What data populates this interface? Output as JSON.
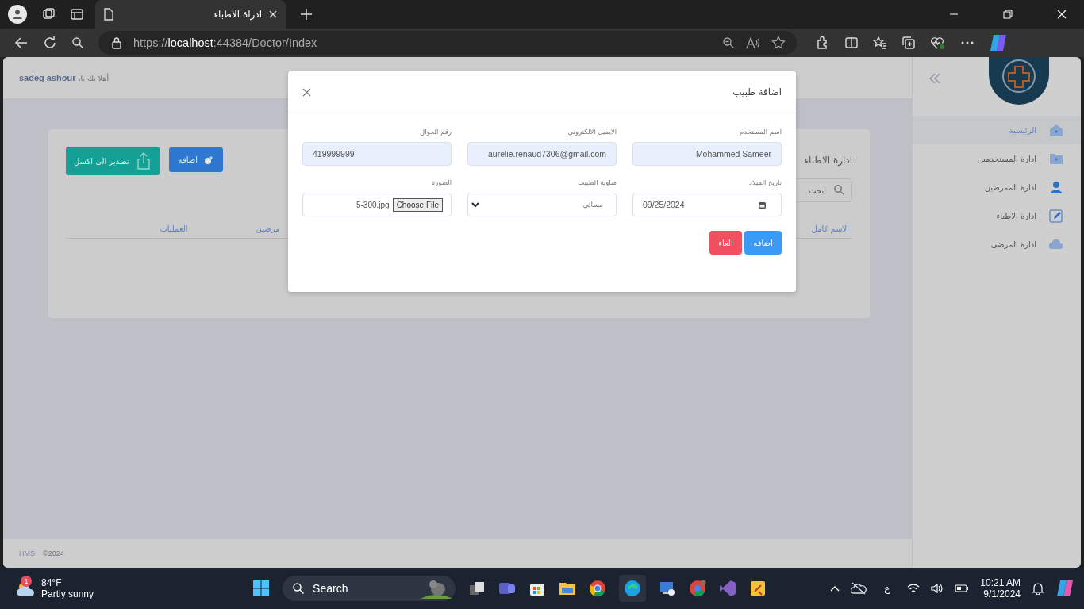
{
  "browser": {
    "tabs": [
      {
        "title": "ادراة الاطباء",
        "selected": true
      }
    ],
    "url": {
      "scheme": "https://",
      "host": "localhost",
      "path": ":44384/Doctor/Index"
    }
  },
  "header": {
    "greeting": "أهلا بك يا،",
    "user": "sadeg ashour"
  },
  "sidebar": {
    "items": [
      {
        "label": "الرئيسية",
        "selected": true
      },
      {
        "label": "ادارة المستخدمين",
        "selected": false
      },
      {
        "label": "ادارة الممرضين",
        "selected": false
      },
      {
        "label": "ادارة الاطباء",
        "selected": false
      },
      {
        "label": "ادارة المرضى",
        "selected": false
      }
    ]
  },
  "card": {
    "title": "ادارة الاطباء",
    "add_button": "اضافة",
    "export_button": "تصدير الى اكسل",
    "search": {
      "placeholder": "أبحث"
    },
    "table": {
      "columns": [
        "الاسم كامل",
        "مرضين",
        "العمليات"
      ]
    }
  },
  "modal": {
    "title": "اضافة طبيب",
    "fields": [
      {
        "kind": "text",
        "label": "اسم المستخدم",
        "value": "Mohammed Sameer"
      },
      {
        "kind": "text",
        "label": "الايميل الالكتروني",
        "value": "aurelie.renaud7306@gmail.com"
      },
      {
        "kind": "text",
        "label": "رقم الجوال",
        "value": "419999999"
      },
      {
        "kind": "date",
        "label": "تاريخ الميلاد",
        "value": "09/25/2024"
      },
      {
        "kind": "select",
        "label": "مناوبة الطبيب",
        "value": "مسائي"
      },
      {
        "kind": "file",
        "label": "الصورة",
        "button": "Choose File",
        "value": "5-300.jpg"
      }
    ],
    "buttons": [
      {
        "kind": "primary",
        "label": "اضافه"
      },
      {
        "kind": "danger",
        "label": "الغاء"
      }
    ]
  },
  "footer": {
    "brand": "HMS",
    "year": "©2024"
  },
  "taskbar": {
    "weather": {
      "temp": "84°F",
      "text": "Partly sunny",
      "badge": "1"
    },
    "search": "Search",
    "language": "ع",
    "time": "10:21 AM",
    "date": "9/1/2024"
  }
}
